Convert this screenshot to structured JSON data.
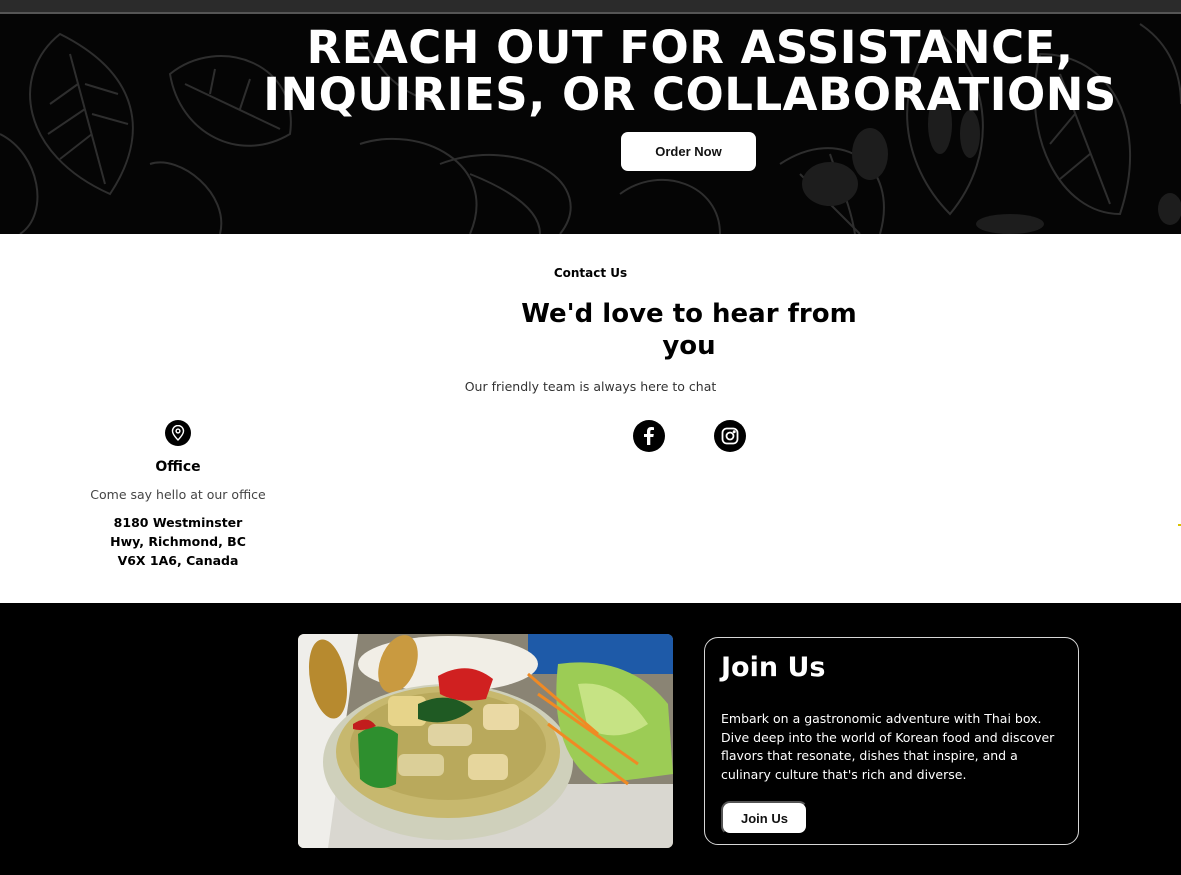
{
  "hero": {
    "title_line1": "REACH OUT FOR ASSISTANCE,",
    "title_line2": "INQUIRIES, OR COLLABORATIONS",
    "order_button": "Order Now"
  },
  "contact": {
    "eyebrow": "Contact Us",
    "heading": "We'd love to hear from you",
    "subtitle": "Our friendly team is always here to chat",
    "social": [
      {
        "icon": "facebook-icon"
      },
      {
        "icon": "instagram-icon"
      }
    ]
  },
  "office": {
    "icon": "map-pin-icon",
    "title": "Office",
    "subtitle": "Come say hello at our office",
    "address": "8180 Westminster Hwy, Richmond, BC V6X 1A6, Canada"
  },
  "join": {
    "title": "Join Us",
    "text": "Embark on a gastronomic adventure with Thai box. Dive deep into the world of Korean food and discover flavors that resonate, dishes that inspire, and a culinary culture that's rich and diverse.",
    "button": "Join Us"
  },
  "colors": {
    "hero_bg": "#050505",
    "section_bg": "#ffffff",
    "join_bg": "#000000",
    "button_bg": "#ffffff"
  }
}
